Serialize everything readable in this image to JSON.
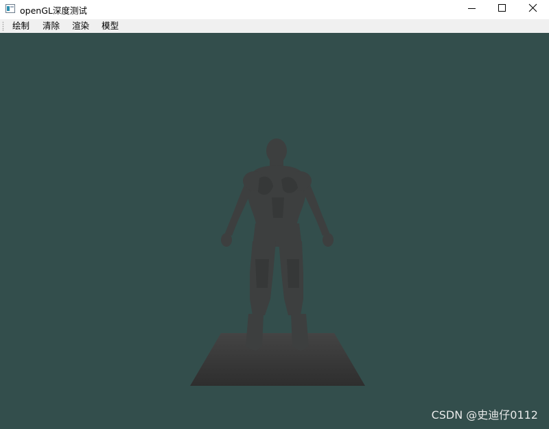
{
  "window": {
    "title": "openGL深度测试"
  },
  "menu": {
    "items": [
      {
        "label": "绘制"
      },
      {
        "label": "清除"
      },
      {
        "label": "渲染"
      },
      {
        "label": "模型"
      }
    ]
  },
  "viewport": {
    "clear_color": "#334e4c",
    "model_color": "#3d3f3f",
    "floor_color": "#333333"
  },
  "watermark": {
    "text": "CSDN @史迪仔0112"
  }
}
